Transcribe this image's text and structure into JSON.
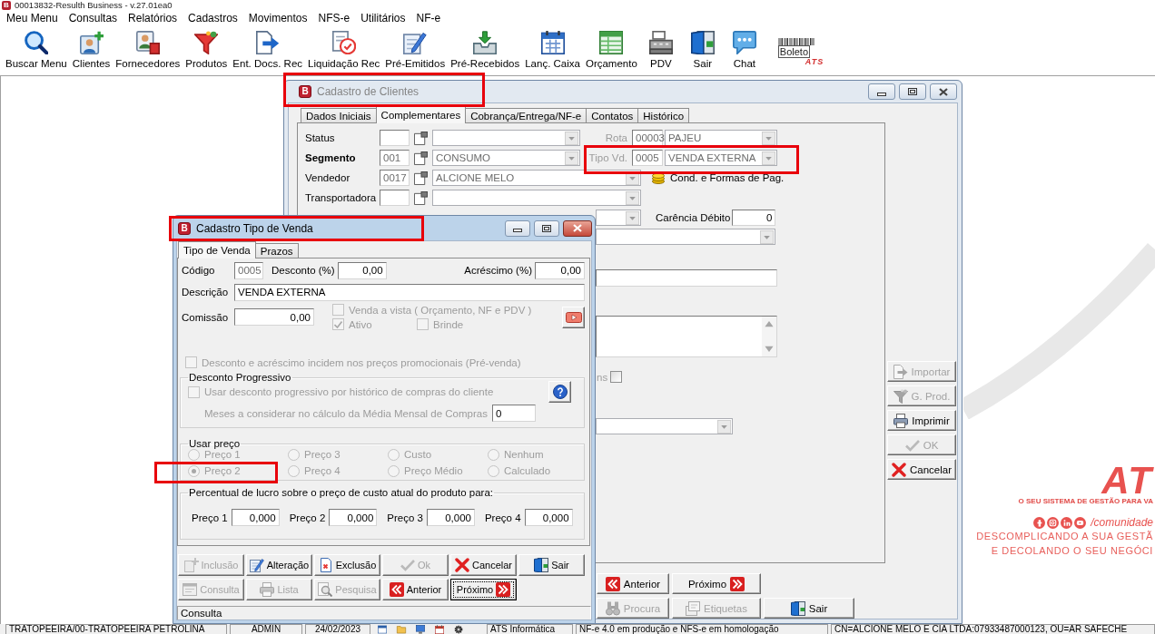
{
  "app_icon_letter": "B",
  "app_title": "00013832-Resulth Business - v.27.01ea0",
  "menu": [
    "Meu Menu",
    "Consultas",
    "Relatórios",
    "Cadastros",
    "Movimentos",
    "NFS-e",
    "Utilitários",
    "NF-e"
  ],
  "toolbar": [
    {
      "label": "Buscar Menu",
      "kind": "search"
    },
    {
      "label": "Clientes",
      "kind": "client"
    },
    {
      "label": "Fornecedores",
      "kind": "supplier"
    },
    {
      "label": "Produtos",
      "kind": "funnel"
    },
    {
      "label": "Ent. Docs. Rec",
      "kind": "import"
    },
    {
      "label": "Liquidação Rec",
      "kind": "settle"
    },
    {
      "label": "Pré-Emitidos",
      "kind": "edit"
    },
    {
      "label": "Pré-Recebidos",
      "kind": "inbox"
    },
    {
      "label": "Lanç. Caixa",
      "kind": "calendar"
    },
    {
      "label": "Orçamento",
      "kind": "sheet"
    },
    {
      "label": "PDV",
      "kind": "register"
    },
    {
      "label": "Sair",
      "kind": "exit"
    },
    {
      "label": "Chat",
      "kind": "chat"
    }
  ],
  "boleto_logo": {
    "text": "Boleto",
    "brand": "ATS"
  },
  "branding": {
    "logo": "AT",
    "tagline": "O SEU SISTEMA DE GESTÃO PARA VA",
    "handle": "/comunidade",
    "slogan": [
      "DESCOMPLICANDO A SUA GESTÃ",
      "E DECOLANDO O SEU NEGÓCI"
    ]
  },
  "client_window": {
    "icon_letter": "B",
    "title": "Cadastro de Clientes",
    "active": false,
    "highlighted": true,
    "tabs": [
      {
        "label": "Dados Iniciais",
        "selected": false
      },
      {
        "label": "Complementares",
        "selected": true
      },
      {
        "label": "Cobrança/Entrega/NF-e",
        "selected": false
      },
      {
        "label": "Contatos",
        "selected": false
      },
      {
        "label": "Histórico",
        "selected": false
      }
    ],
    "rows": [
      {
        "label": "Status",
        "required": false,
        "side": {
          "kind": "lookup",
          "label": "Rota",
          "code": "00003",
          "value": "PAJEU",
          "disabled": true
        }
      },
      {
        "label": "Segmento",
        "required": true,
        "code": "001",
        "value": "CONSUMO",
        "side": {
          "kind": "lookup",
          "label": "Tipo Vd.",
          "code": "0005",
          "value": "VENDA EXTERNA",
          "disabled": true,
          "highlighted": true
        }
      },
      {
        "label": "Vendedor",
        "required": false,
        "code": "0017",
        "value": "ALCIONE MELO",
        "side": {
          "kind": "link",
          "label": "Cond. e Formas de Pag."
        }
      },
      {
        "label": "Transportadora",
        "required": false
      }
    ],
    "carencia": {
      "label": "Carência Débito",
      "value": "0"
    },
    "option_check": {
      "label": "ns",
      "checked": false
    },
    "side_buttons": [
      {
        "label": "Importar",
        "kind": "import",
        "disabled": true
      },
      {
        "label": "G. Prod.",
        "kind": "funnel",
        "disabled": true
      },
      {
        "label": "Imprimir",
        "kind": "print",
        "disabled": false
      },
      {
        "label": "OK",
        "kind": "check",
        "disabled": true
      },
      {
        "label": "Cancelar",
        "kind": "cancel",
        "disabled": false
      }
    ],
    "nav_buttons": [
      [
        {
          "label": "Anterior",
          "kind": "prev",
          "disabled": false
        },
        {
          "label": "Próximo",
          "kind": "next",
          "disabled": false
        }
      ],
      [
        {
          "label": "Procura",
          "kind": "binoculars",
          "disabled": true
        },
        {
          "label": "Etiquetas",
          "kind": "labels",
          "disabled": true
        },
        {
          "label": "Sair",
          "kind": "exit",
          "disabled": false
        }
      ]
    ]
  },
  "sale_type_window": {
    "icon_letter": "B",
    "title": "Cadastro Tipo de Venda",
    "active": true,
    "highlighted": true,
    "tabs": [
      {
        "label": "Tipo de Venda",
        "selected": true
      },
      {
        "label": "Prazos",
        "selected": false
      }
    ],
    "codigo": {
      "label": "Código",
      "value": "0005"
    },
    "desconto": {
      "label": "Desconto (%)",
      "value": "0,00"
    },
    "acrescimo": {
      "label": "Acréscimo (%)",
      "value": "0,00"
    },
    "descricao": {
      "label": "Descrição",
      "value": "VENDA EXTERNA"
    },
    "comissao": {
      "label": "Comissão",
      "value": "0,00"
    },
    "options": [
      {
        "label": "Venda a vista ( Orçamento, NF e PDV )",
        "checked": false,
        "disabled": true
      },
      {
        "label": "Ativo",
        "checked": true,
        "disabled": true
      },
      {
        "label": "Brinde",
        "checked": false,
        "disabled": true
      }
    ],
    "promo_check": {
      "label": "Desconto e acréscimo incidem nos preços promocionais (Pré-venda)",
      "checked": false,
      "disabled": true
    },
    "progressive": {
      "title": "Desconto Progressivo",
      "check": {
        "label": "Usar desconto progressivo por histórico de compras do cliente",
        "checked": false,
        "disabled": true
      },
      "months": {
        "label": "Meses a considerar no cálculo da Média Mensal de Compras",
        "value": "0",
        "disabled": true
      }
    },
    "price_usage": {
      "title": "Usar preço",
      "options": [
        {
          "label": "Preço 1",
          "selected": false,
          "disabled": true,
          "highlighted": false
        },
        {
          "label": "Preço 3",
          "selected": false,
          "disabled": true,
          "highlighted": false
        },
        {
          "label": "Custo",
          "selected": false,
          "disabled": true,
          "highlighted": false
        },
        {
          "label": "Nenhum",
          "selected": false,
          "disabled": true,
          "highlighted": false
        },
        {
          "label": "Preço 2",
          "selected": true,
          "disabled": true,
          "highlighted": true
        },
        {
          "label": "Preço 4",
          "selected": false,
          "disabled": true,
          "highlighted": false
        },
        {
          "label": "Preço Médio",
          "selected": false,
          "disabled": true,
          "highlighted": false
        },
        {
          "label": "Calculado",
          "selected": false,
          "disabled": true,
          "highlighted": false
        }
      ]
    },
    "profit": {
      "title": "Percentual de lucro sobre o preço de custo atual do produto para:",
      "fields": [
        {
          "label": "Preço 1",
          "value": "0,000"
        },
        {
          "label": "Preço 2",
          "value": "0,000"
        },
        {
          "label": "Preço 3",
          "value": "0,000"
        },
        {
          "label": "Preço 4",
          "value": "0,000"
        }
      ]
    },
    "buttons": [
      [
        {
          "label": "Inclusão",
          "kind": "add",
          "disabled": true,
          "focused": false
        },
        {
          "label": "Alteração",
          "kind": "edit",
          "disabled": false,
          "focused": false
        },
        {
          "label": "Exclusão",
          "kind": "delete",
          "disabled": false,
          "focused": false
        },
        {
          "label": "Ok",
          "kind": "check",
          "disabled": true,
          "focused": false
        },
        {
          "label": "Cancelar",
          "kind": "cancel",
          "disabled": false,
          "focused": false
        },
        {
          "label": "Sair",
          "kind": "exit",
          "disabled": false,
          "focused": false
        }
      ],
      [
        {
          "label": "Consulta",
          "kind": "query",
          "disabled": true,
          "focused": false
        },
        {
          "label": "Lista",
          "kind": "print",
          "disabled": true,
          "focused": false
        },
        {
          "label": "Pesquisa",
          "kind": "find",
          "disabled": true,
          "focused": false
        },
        {
          "label": "Anterior",
          "kind": "prev",
          "disabled": false,
          "focused": false
        },
        {
          "label": "Próximo",
          "kind": "next",
          "disabled": false,
          "focused": true
        }
      ]
    ],
    "status": "Consulta"
  },
  "status_bar": {
    "company": "TRATOPEEIRA/00-TRATOPEEIRA PETROLINA",
    "user": "ADMIN",
    "date": "24/02/2023",
    "vendor": "ATS Informática",
    "nfe_mode": "NF-e 4.0 em produção e NFS-e em homologação",
    "certificate": "CN=ALCIONE MELO E CIA LTDA:07933487000123, OU=AR SAFECHE"
  }
}
